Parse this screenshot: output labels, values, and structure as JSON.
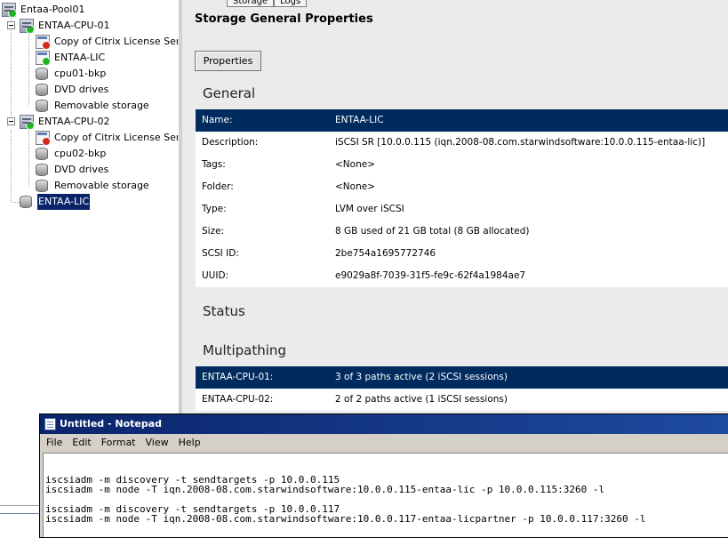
{
  "tree": {
    "pool": "Entaa-Pool01",
    "host1": "ENTAA-CPU-01",
    "host1_children": [
      "Copy of Citrix License Server",
      "ENTAA-LIC",
      "cpu01-bkp",
      "DVD drives",
      "Removable storage"
    ],
    "host2": "ENTAA-CPU-02",
    "host2_children": [
      "Copy of Citrix License Server",
      "cpu02-bkp",
      "DVD drives",
      "Removable storage"
    ],
    "selected_sr": "ENTAA-LIC"
  },
  "tabs": [
    "Storage",
    "Logs"
  ],
  "main": {
    "title": "Storage General Properties",
    "properties_button": "Properties",
    "general_header": "General",
    "general": [
      {
        "key": "Name:",
        "value": "ENTAA-LIC"
      },
      {
        "key": "Description:",
        "value": "iSCSI SR [10.0.0.115 (iqn.2008-08.com.starwindsoftware:10.0.0.115-entaa-lic)]"
      },
      {
        "key": "Tags:",
        "value": "<None>"
      },
      {
        "key": "Folder:",
        "value": "<None>"
      },
      {
        "key": "Type:",
        "value": "LVM over iSCSI"
      },
      {
        "key": "Size:",
        "value": "8 GB used of 21 GB total (8 GB allocated)"
      },
      {
        "key": "SCSI ID:",
        "value": "2be754a1695772746"
      },
      {
        "key": "UUID:",
        "value": "e9029a8f-7039-31f5-fe9c-62f4a1984ae7"
      }
    ],
    "status_header": "Status",
    "multipathing_header": "Multipathing",
    "multipathing": [
      {
        "key": "ENTAA-CPU-01:",
        "value": "3 of 3 paths active (2 iSCSI sessions)"
      },
      {
        "key": "ENTAA-CPU-02:",
        "value": "2 of 2 paths active (1 iSCSI sessions)"
      }
    ]
  },
  "notepad": {
    "title": "Untitled - Notepad",
    "menu": [
      "File",
      "Edit",
      "Format",
      "View",
      "Help"
    ],
    "lines": [
      "iscsiadm -m discovery -t sendtargets -p 10.0.0.115",
      "iscsiadm -m node -T iqn.2008-08.com.starwindsoftware:10.0.0.115-entaa-lic -p 10.0.0.115:3260 -l",
      "iscsiadm -m discovery -t sendtargets -p 10.0.0.117",
      "iscsiadm -m node -T iqn.2008-08.com.starwindsoftware:10.0.0.117-entaa-licpartner -p 10.0.0.117:3260 -l"
    ]
  },
  "icons": {
    "pool": "pool-icon",
    "host": "server-icon",
    "vm": "vm-icon",
    "disk": "disk-icon"
  },
  "colors": {
    "selection": "#0a246a",
    "selected_row": "#002b5e",
    "pane_bg": "#ebebeb",
    "running": "#1eb81e",
    "stopped": "#d42a1a"
  }
}
